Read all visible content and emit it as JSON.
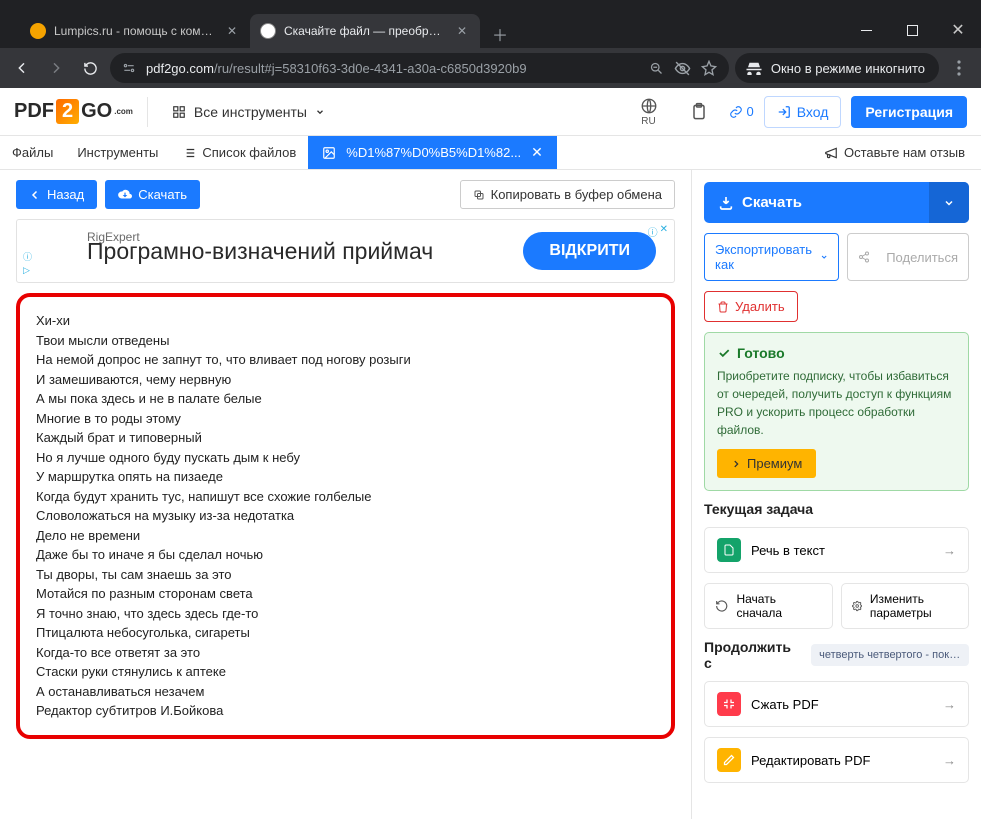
{
  "browser": {
    "tabs": [
      {
        "title": "Lumpics.ru - помощь с компьюте",
        "favicon_color": "#f5a300"
      },
      {
        "title": "Скачайте файл — преобразов",
        "favicon_color": "#1b7aff"
      }
    ],
    "url_host": "pdf2go.com",
    "url_path": "/ru/result#j=58310f63-3d0e-4341-a30a-c6850d3920b9",
    "incognito_label": "Окно в режиме инкогнито"
  },
  "header": {
    "logo_pdf": "PDF",
    "logo_2": "2",
    "logo_go": "GO",
    "logo_dotcom": ".com",
    "tools": "Все инструменты",
    "lang": "RU",
    "queue": "0",
    "login": "Вход",
    "register": "Регистрация"
  },
  "subheader": {
    "files": "Файлы",
    "tools": "Инструменты",
    "filelist": "Список файлов",
    "active_tab": "%D1%87%D0%B5%D1%82...",
    "feedback": "Оставьте нам отзыв"
  },
  "actions": {
    "back": "Назад",
    "download": "Скачать",
    "copy": "Копировать в буфер обмена"
  },
  "ad": {
    "brand": "RigExpert",
    "text": "Програмно-визначений приймач",
    "cta": "ВІДКРИТИ"
  },
  "result_lines": [
    "Хи-хи",
    "Твои мысли отведены",
    "На немой допрос не запнут то, что вливает под ногову розыги",
    "И замешиваются, чему нервную",
    "А мы пока здесь и не в палате белые",
    "Многие в то роды этому",
    "Каждый брат и типоверный",
    "Но я лучше одного буду пускать дым к небу",
    "У маршрутка опять на пизаеде",
    "Когда будут хранить тус, напишут все схожие голбелые",
    "Словоложаться на музыку из-за недотатка",
    "Дело не времени",
    "Даже бы то иначе я бы сделал ночью",
    "Ты дворы, ты сам знаешь за это",
    "Мотайся по разным сторонам света",
    "Я точно знаю, что здесь здесь где-то",
    "Птицалюта небосуголька, сигареты",
    "Когда-то все ответят за это",
    "Стаски руки стянулись к аптеке",
    "А останавливаться незачем",
    "Редактор субтитров И.Бойкова"
  ],
  "side": {
    "download": "Скачать",
    "export_as": "Экспортировать как",
    "share": "Поделиться",
    "delete": "Удалить",
    "ready_title": "Готово",
    "ready_desc": "Приобретите подписку, чтобы избавиться от очередей, получить доступ к функциям PRO и ускорить процесс обработки файлов.",
    "premium": "Премиум",
    "current_task_title": "Текущая задача",
    "current_task": "Речь в текст",
    "restart": "Начать сначала",
    "change_params": "Изменить параметры",
    "continue_title": "Продолжить с",
    "continue_chip": "четверть четвертого - пока з...",
    "compress": "Сжать PDF",
    "edit": "Редактировать PDF"
  }
}
